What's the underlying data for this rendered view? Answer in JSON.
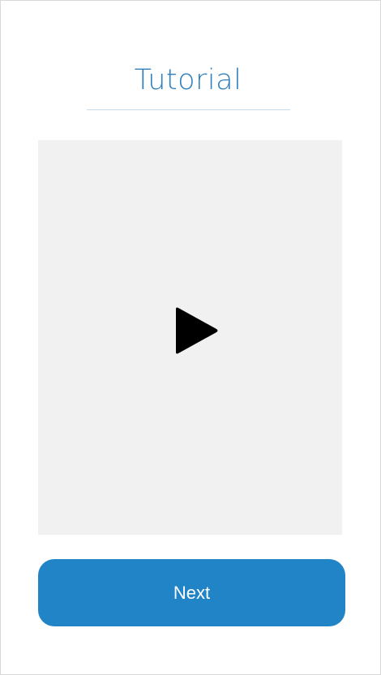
{
  "header": {
    "title": "Tutorial"
  },
  "video": {
    "play_icon": "play-icon"
  },
  "footer": {
    "next_label": "Next"
  },
  "colors": {
    "accent": "#2184c6",
    "title": "#2e7fbd",
    "video_background": "#f1f1f1",
    "divider": "#c9dbe9"
  }
}
